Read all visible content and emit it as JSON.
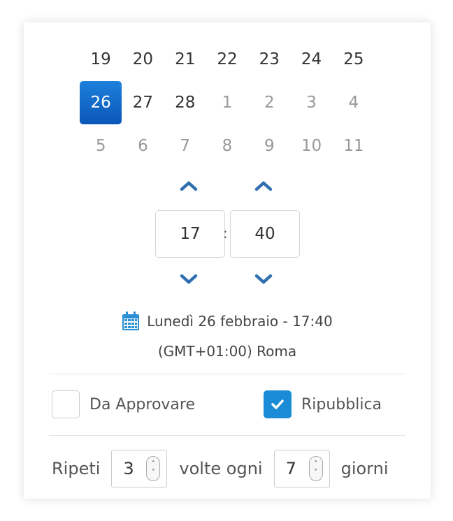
{
  "calendar": {
    "weeks": [
      [
        {
          "day": "19",
          "other": false
        },
        {
          "day": "20",
          "other": false
        },
        {
          "day": "21",
          "other": false
        },
        {
          "day": "22",
          "other": false
        },
        {
          "day": "23",
          "other": false
        },
        {
          "day": "24",
          "other": false
        },
        {
          "day": "25",
          "other": false
        }
      ],
      [
        {
          "day": "26",
          "other": false,
          "selected": true
        },
        {
          "day": "27",
          "other": false
        },
        {
          "day": "28",
          "other": false
        },
        {
          "day": "1",
          "other": true
        },
        {
          "day": "2",
          "other": true
        },
        {
          "day": "3",
          "other": true
        },
        {
          "day": "4",
          "other": true
        }
      ],
      [
        {
          "day": "5",
          "other": true
        },
        {
          "day": "6",
          "other": true
        },
        {
          "day": "7",
          "other": true
        },
        {
          "day": "8",
          "other": true
        },
        {
          "day": "9",
          "other": true
        },
        {
          "day": "10",
          "other": true
        },
        {
          "day": "11",
          "other": true
        }
      ]
    ]
  },
  "time": {
    "hour": "17",
    "minute": "40",
    "separator": ":"
  },
  "summary": {
    "date_text": "Lunedì 26 febbraio - 17:40",
    "timezone": "(GMT+01:00) Roma",
    "icon": "calendar-icon"
  },
  "options": {
    "approve_label": "Da Approvare",
    "approve_checked": false,
    "republish_label": "Ripubblica",
    "republish_checked": true
  },
  "repeat": {
    "label_repeat": "Ripeti",
    "times_value": "3",
    "label_every": "volte ogni",
    "days_value": "7",
    "label_days": "giorni"
  },
  "colors": {
    "accent": "#1a8bd6",
    "selected_day": "#0a56b6",
    "arrow": "#2f6fb0"
  }
}
